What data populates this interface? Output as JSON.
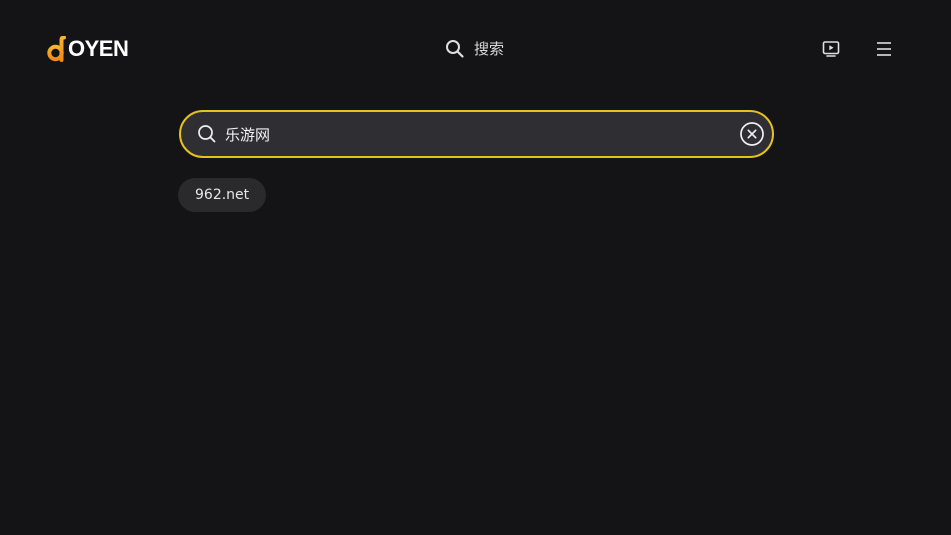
{
  "header": {
    "logo_text": "OYEN",
    "search_label": "搜索",
    "icons": {
      "search": "search-icon",
      "tv": "tv-play-icon",
      "menu": "hamburger-menu-icon"
    }
  },
  "search": {
    "value": "乐游网",
    "placeholder": "",
    "clear_icon": "clear-circle-icon"
  },
  "suggestions": [
    {
      "label": "962.net"
    }
  ],
  "colors": {
    "background": "#141416",
    "accent": "#e6c31c",
    "logo_orange": "#f5a623",
    "search_bg": "#2f2f33",
    "chip_bg": "#2a2a2d"
  }
}
